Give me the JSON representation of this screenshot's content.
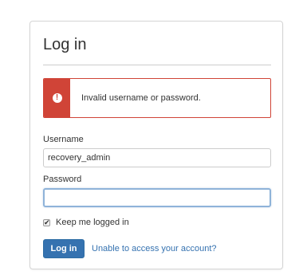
{
  "form": {
    "title": "Log in",
    "alert": {
      "message": "Invalid username or password.",
      "icon": "error-icon",
      "color": "#d04437"
    },
    "username": {
      "label": "Username",
      "value": "recovery_admin"
    },
    "password": {
      "label": "Password",
      "value": ""
    },
    "remember": {
      "label": "Keep me logged in",
      "checked": true
    },
    "submit_label": "Log in",
    "help_link": "Unable to access your account?",
    "accent_color": "#3572b0"
  }
}
